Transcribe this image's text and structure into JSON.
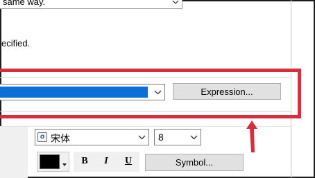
{
  "top": {
    "dropdown_text": "same way.",
    "note_text": "ecified."
  },
  "color_row": {
    "swatch_color": "#0a6fd8",
    "expression_button": "Expression..."
  },
  "font_row": {
    "font_icon": "o",
    "font_name": "宋体",
    "font_size": "8"
  },
  "style_row": {
    "text_color": "#000000",
    "bold_label": "B",
    "italic_label": "I",
    "underline_label": "U",
    "symbol_button": "Symbol..."
  },
  "annotation": {
    "highlight_color": "#d92c3d"
  }
}
